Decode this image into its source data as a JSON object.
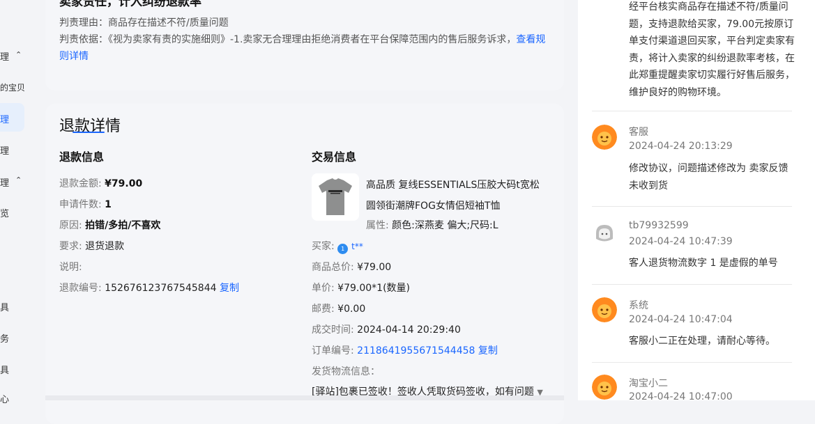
{
  "sidebar": {
    "items": [
      {
        "label": "理",
        "chevron": "⌃"
      },
      {
        "label": "的宝贝"
      },
      {
        "label": "理"
      },
      {
        "label": "理"
      },
      {
        "label": "理",
        "chevron": "⌃"
      },
      {
        "label": "览"
      },
      {
        "label": "具"
      },
      {
        "label": "务"
      },
      {
        "label": "具"
      },
      {
        "label": "心"
      }
    ]
  },
  "duty": {
    "title": "卖家责任，计入纠纷退款率",
    "reason_label": "判责理由：",
    "reason": "商品存在描述不符/质量问题",
    "basis_label": "判责依据：",
    "basis": "《视为卖家有责的实施细则》-1.卖家无合理理由拒绝消费者在平台保障范围内的售后服务诉求，",
    "link": "查看规则详情"
  },
  "refund": {
    "section_title": "退款详情",
    "info_title": "退款信息",
    "amount_label": "退款金额:",
    "amount": "¥79.00",
    "count_label": "申请件数:",
    "count": "1",
    "reason_label": "原因:",
    "reason": "拍错/多拍/不喜欢",
    "request_label": "要求:",
    "request": "退货退款",
    "note_label": "说明:",
    "note": "",
    "id_label": "退款编号:",
    "id": "152676123767545844",
    "copy": "复制"
  },
  "trade": {
    "title": "交易信息",
    "product_title": "高品质 复线ESSENTIALS压胶大码t宽松圆领街潮牌FOG女情侣短袖T恤",
    "attr_label": "属性:",
    "attr": "颜色:深燕麦 偏大;尺码:L",
    "buyer_label": "买家:",
    "buyer": "t**",
    "total_label": "商品总价:",
    "total": "¥79.00",
    "unit_label": "单价:",
    "unit": "¥79.00*1(数量)",
    "postage_label": "邮费:",
    "postage": "¥0.00",
    "deal_time_label": "成交时间:",
    "deal_time": "2024-04-14 20:29:40",
    "order_label": "订单编号:",
    "order_id": "2118641955671544458",
    "copy": "复制",
    "logistics_label": "发货物流信息：",
    "logistics": "[驿站]包裹已签收！签收人凭取货码签收，如有问题"
  },
  "timeline": {
    "top_text": "经平台核实商品存在描述不符/质量问题，支持退款给买家，79.00元按原订单支付渠道退回买家，平台判定卖家有责，将计入卖家的纠纷退款率考核，在此郑重提醒卖家切实履行好售后服务，维护良好的购物环境。",
    "entries": [
      {
        "name": "客服",
        "time": "2024-04-24 20:13:29",
        "text": "修改协议，问题描述修改为  卖家反馈未收到货"
      },
      {
        "name": "tb79932599",
        "time": "2024-04-24 10:47:39",
        "text": "客人退货物流数字 1   是虚假的单号"
      },
      {
        "name": "系统",
        "time": "2024-04-24 10:47:04",
        "text": "客服小二正在处理，请耐心等待。"
      },
      {
        "name": "淘宝小二",
        "time": "2024-04-24 10:47:00",
        "text": ""
      }
    ]
  },
  "colors": {
    "accent": "#1a66ff",
    "avatar_orange": "#ff8a1f"
  }
}
